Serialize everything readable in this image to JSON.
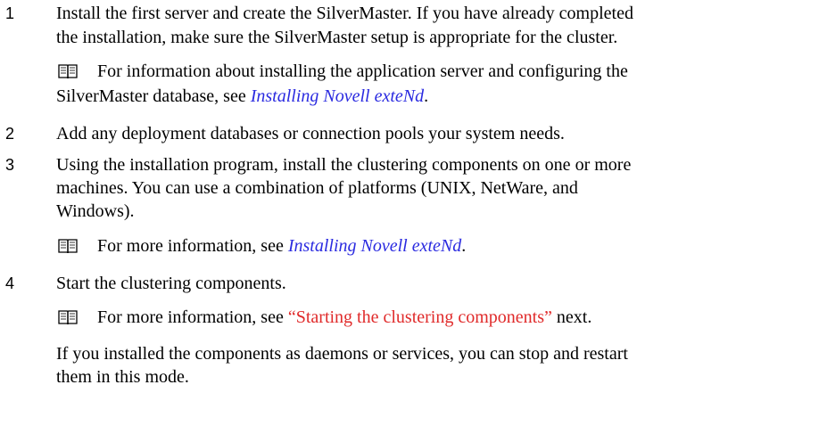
{
  "steps": [
    {
      "number": "1",
      "lines": [
        "Install the first server and create the SilverMaster. If you have already completed",
        "the installation, make sure the SilverMaster setup is appropriate for the cluster."
      ],
      "note": {
        "icon": "book-icon",
        "line1": "For information about installing the application server and configuring the",
        "line2_prefix": "SilverMaster database, see ",
        "link": "Installing Novell exteNd",
        "line2_suffix": "."
      }
    },
    {
      "number": "2",
      "lines": [
        "Add any deployment databases or connection pools your system needs."
      ]
    },
    {
      "number": "3",
      "lines": [
        "Using the installation program, install the clustering components on one or more",
        "machines. You can use a combination of platforms (UNIX, NetWare, and",
        "Windows)."
      ],
      "note": {
        "icon": "book-icon",
        "prefix": "For more information, see ",
        "link": "Installing Novell exteNd",
        "suffix": "."
      }
    },
    {
      "number": "4",
      "lines": [
        "Start the clustering components."
      ],
      "note": {
        "icon": "book-icon",
        "prefix": "For more information, see ",
        "link": "“Starting the clustering components”",
        "suffix": " next."
      },
      "after": [
        "If you installed the components as daemons or services, you can stop and restart",
        "them in this mode."
      ]
    }
  ],
  "colors": {
    "link_blue": "#2a2ae0",
    "link_red": "#e02a2a",
    "text": "#000000"
  }
}
